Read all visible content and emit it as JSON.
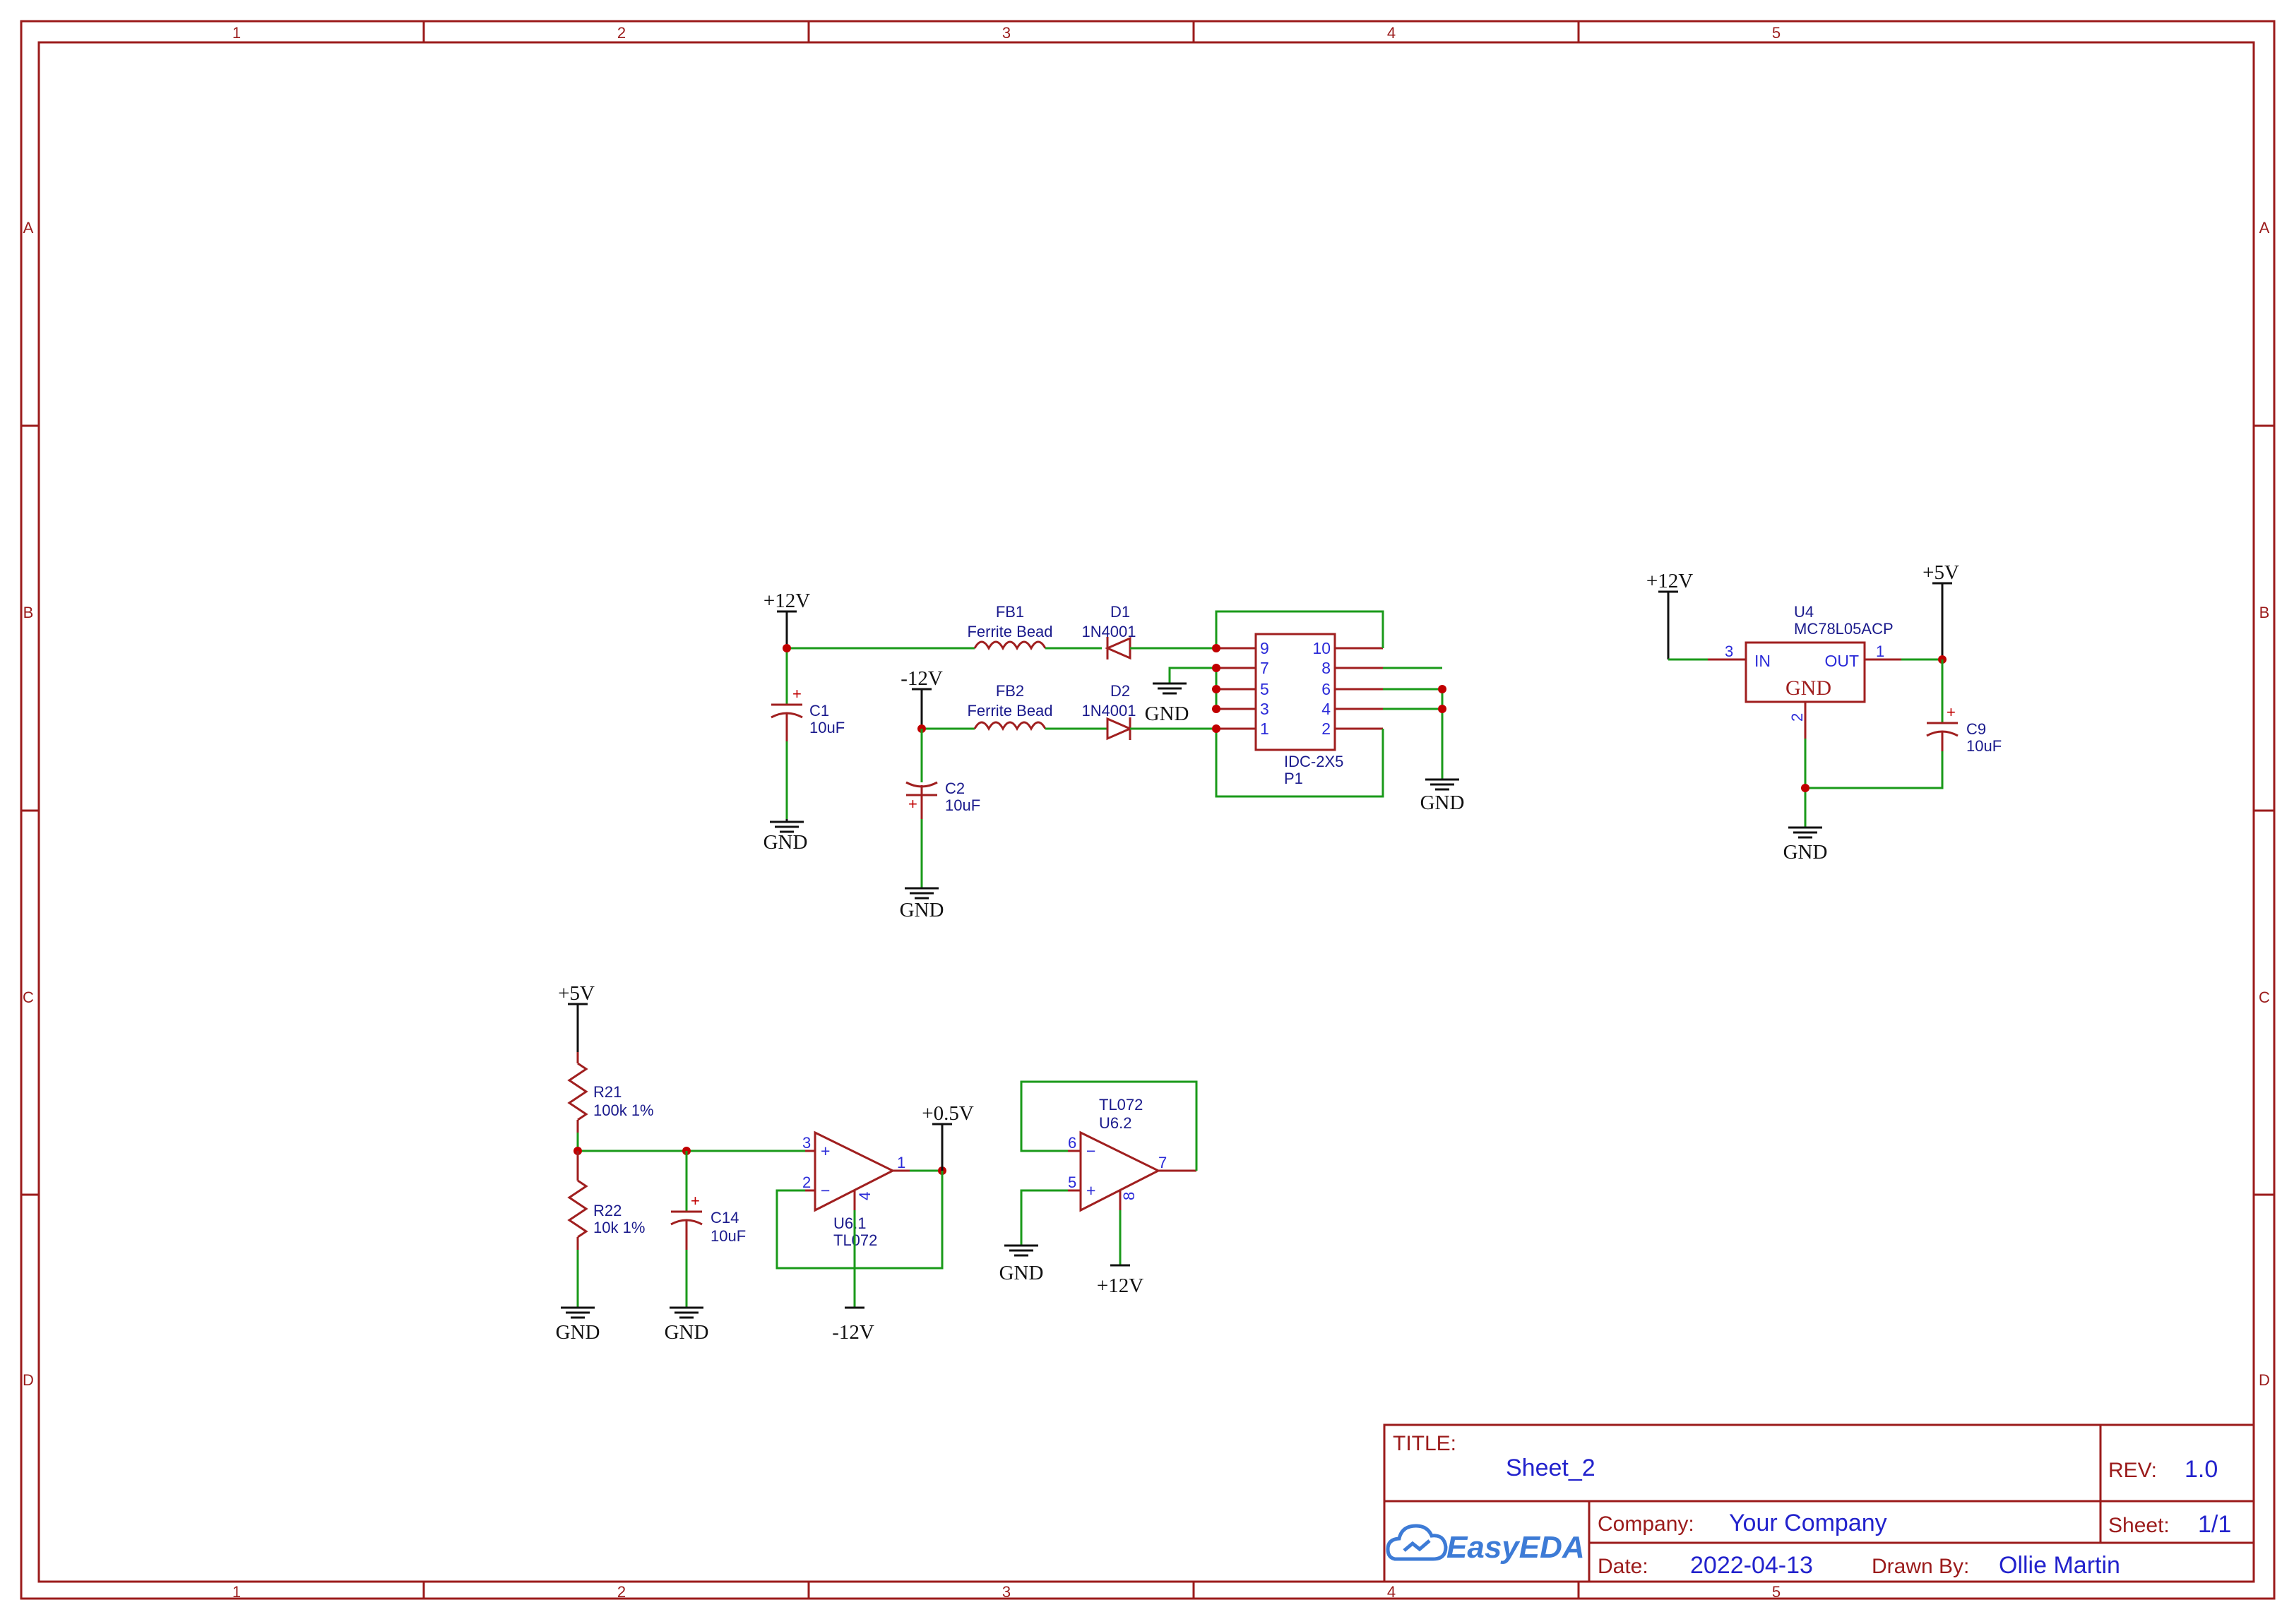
{
  "zones": {
    "columns": [
      "1",
      "2",
      "3",
      "4",
      "5"
    ],
    "rows": [
      "A",
      "B",
      "C",
      "D"
    ]
  },
  "title_block": {
    "title_label": "TITLE:",
    "title_value": "Sheet_2",
    "rev_label": "REV:",
    "rev_value": "1.0",
    "company_label": "Company:",
    "company_value": "Your Company",
    "sheet_label": "Sheet:",
    "sheet_value": "1/1",
    "date_label": "Date:",
    "date_value": "2022-04-13",
    "drawn_by_label": "Drawn By:",
    "drawn_by_value": "Ollie Martin",
    "logo_text": "EasyEDA"
  },
  "nets": {
    "p12": "+12V",
    "m12": "-12V",
    "p5": "+5V",
    "gnd": "GND",
    "p05": "+0.5V"
  },
  "components": {
    "fb1": {
      "ref": "FB1",
      "value": "Ferrite Bead"
    },
    "fb2": {
      "ref": "FB2",
      "value": "Ferrite Bead"
    },
    "d1": {
      "ref": "D1",
      "value": "1N4001"
    },
    "d2": {
      "ref": "D2",
      "value": "1N4001"
    },
    "c1": {
      "ref": "C1",
      "value": "10uF"
    },
    "c2": {
      "ref": "C2",
      "value": "10uF"
    },
    "c9": {
      "ref": "C9",
      "value": "10uF"
    },
    "c14": {
      "ref": "C14",
      "value": "10uF"
    },
    "p1": {
      "ref": "P1",
      "value": "IDC-2X5",
      "pins_left": [
        "9",
        "7",
        "5",
        "3",
        "1"
      ],
      "pins_right": [
        "10",
        "8",
        "6",
        "4",
        "2"
      ]
    },
    "u4": {
      "ref": "U4",
      "value": "MC78L05ACP",
      "pin_in": "IN",
      "pin_out": "OUT",
      "pin_gnd": "GND",
      "num_in": "3",
      "num_out": "1",
      "num_gnd": "2"
    },
    "r21": {
      "ref": "R21",
      "value": "100k 1%"
    },
    "r22": {
      "ref": "R22",
      "value": "10k 1%"
    },
    "u61": {
      "ref": "U6.1",
      "value": "TL072",
      "num_plus": "3",
      "num_minus": "2",
      "num_out": "1",
      "num_v": "4",
      "sign_plus": "+",
      "sign_minus": "−"
    },
    "u62": {
      "ref": "U6.2",
      "value": "TL072",
      "num_plus": "5",
      "num_minus": "6",
      "num_out": "7",
      "num_v": "8",
      "sign_plus": "+",
      "sign_minus": "−"
    }
  },
  "polarity_mark": "+"
}
